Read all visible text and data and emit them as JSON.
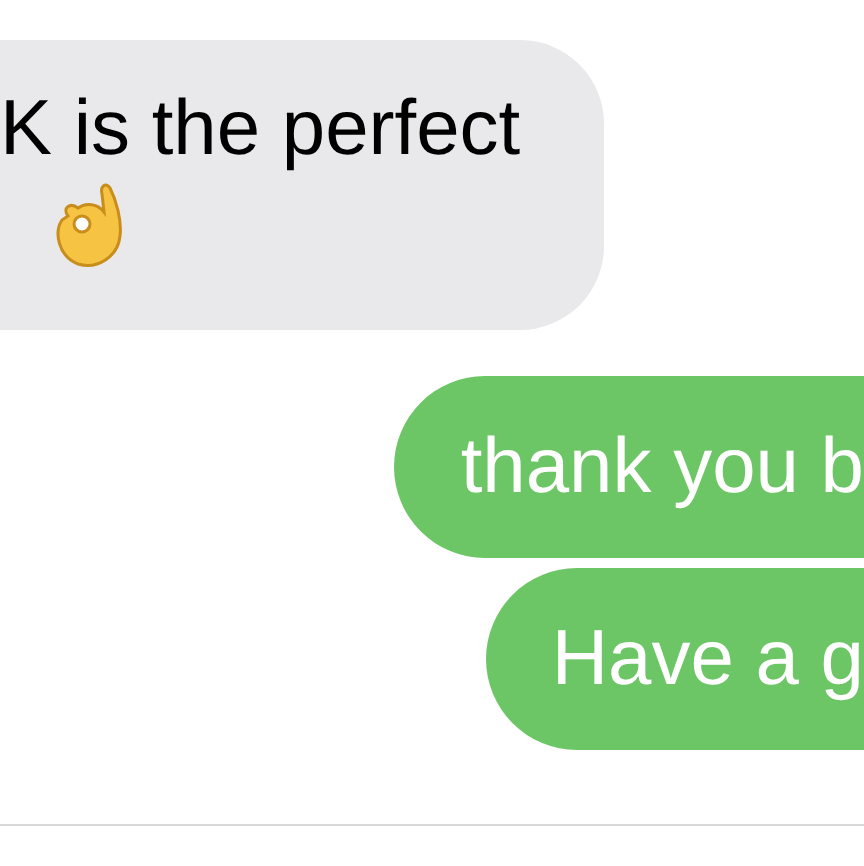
{
  "messages": [
    {
      "kind": "received",
      "text": "K is the perfect",
      "ok_hand": true
    },
    {
      "kind": "sent",
      "text": "thank you b",
      "ok_hand": false
    },
    {
      "kind": "sent",
      "text": "Have a g",
      "ok_hand": false
    }
  ]
}
